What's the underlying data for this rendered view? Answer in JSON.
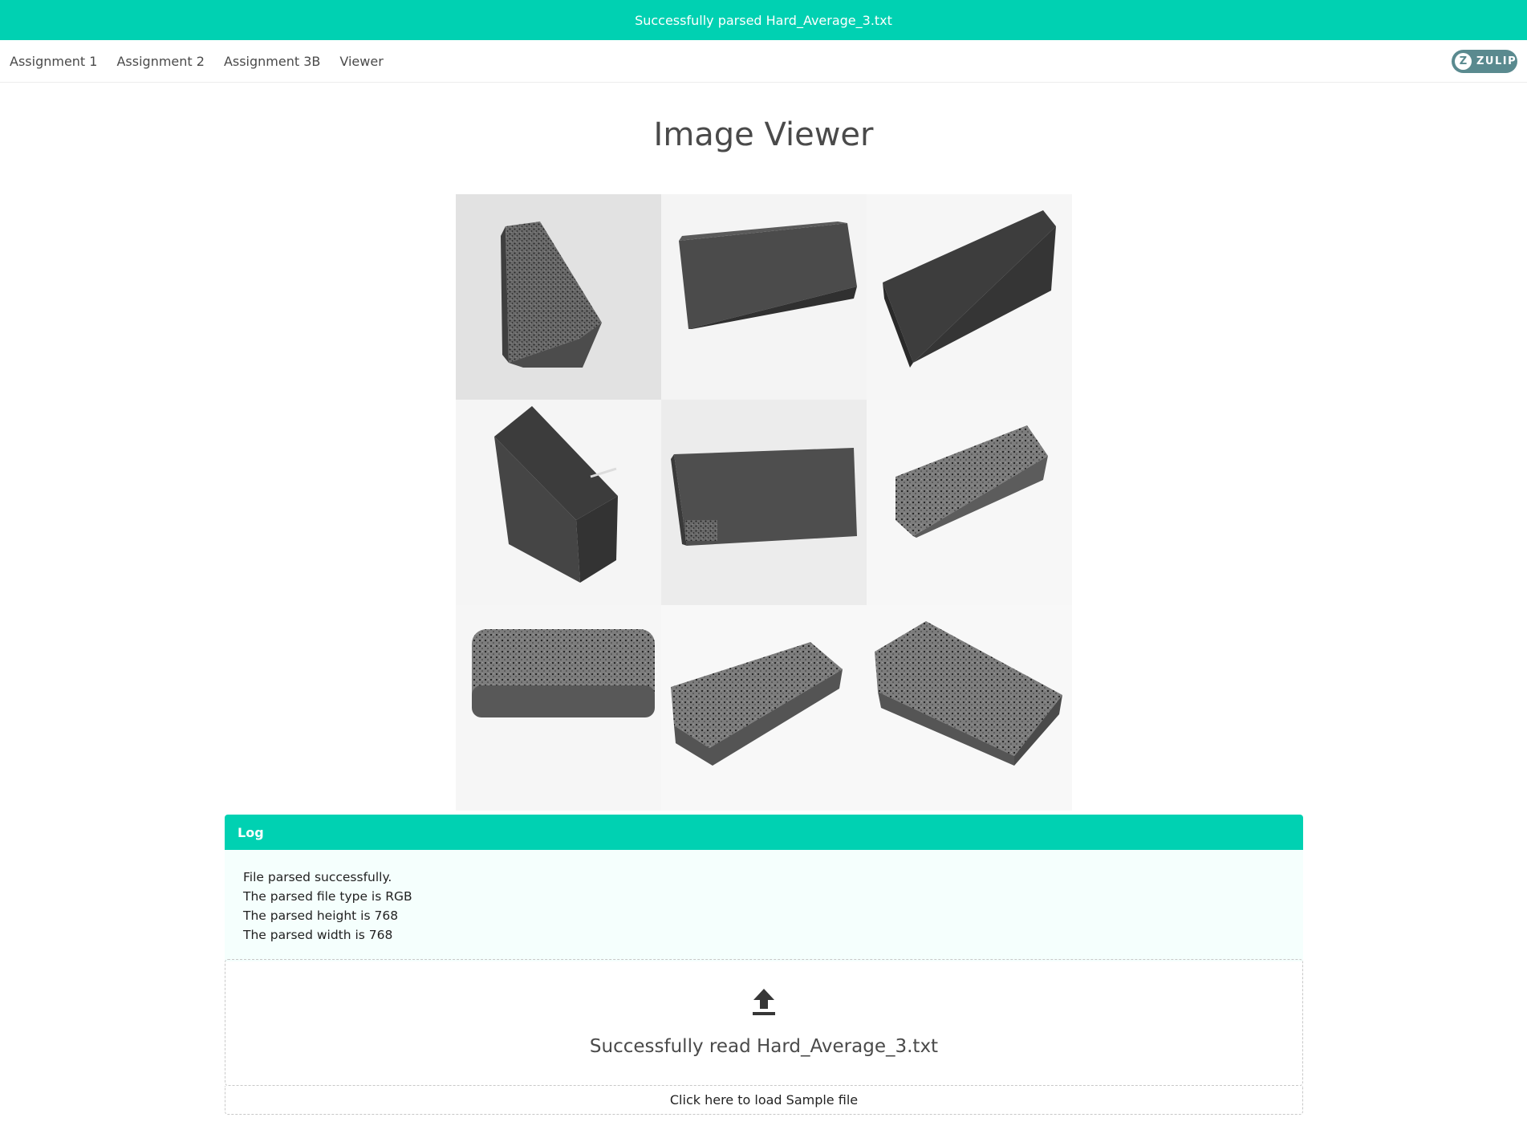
{
  "toast": {
    "message": "Successfully parsed Hard_Average_3.txt"
  },
  "nav": {
    "items": [
      "Assignment 1",
      "Assignment 2",
      "Assignment 3B",
      "Viewer"
    ],
    "badge_letter": "Z",
    "badge_label": "ZULIP"
  },
  "page": {
    "title": "Image Viewer"
  },
  "log": {
    "title": "Log",
    "lines": [
      "File parsed successfully.",
      "The parsed file type is RGB",
      "The parsed height is 768",
      "The parsed width is 768"
    ]
  },
  "upload": {
    "icon": "upload-arrow-icon",
    "message": "Successfully read Hard_Average_3.txt",
    "sample_link": "Click here to load Sample file"
  },
  "colors": {
    "accent": "#00d1b2",
    "log_background": "#f5fffd",
    "badge": "#5a8a8f"
  }
}
